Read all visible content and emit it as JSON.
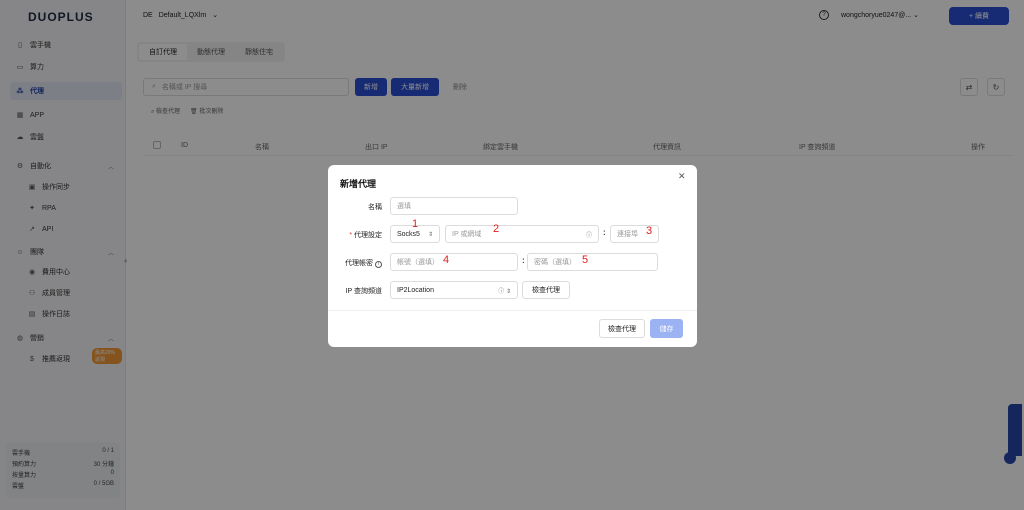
{
  "app": {
    "logo": "DUOPLUS"
  },
  "sidebar": {
    "items": [
      {
        "label": "雲手機",
        "icon": "phone-icon"
      },
      {
        "label": "算力",
        "icon": "monitor-icon"
      },
      {
        "label": "代理",
        "icon": "proxy-icon",
        "active": true
      },
      {
        "label": "APP",
        "icon": "grid-icon"
      },
      {
        "label": "雲盤",
        "icon": "cloud-icon"
      }
    ],
    "groups": [
      {
        "label": "自動化",
        "icon": "automation-icon",
        "children": [
          {
            "label": "操作同步",
            "icon": "sync-icon"
          },
          {
            "label": "RPA",
            "icon": "rpa-icon"
          },
          {
            "label": "API",
            "icon": "api-icon"
          }
        ]
      },
      {
        "label": "團隊",
        "icon": "team-icon",
        "children": [
          {
            "label": "費用中心",
            "icon": "wallet-icon"
          },
          {
            "label": "成員管理",
            "icon": "members-icon"
          },
          {
            "label": "操作日誌",
            "icon": "log-icon"
          }
        ]
      },
      {
        "label": "營銷",
        "icon": "marketing-icon",
        "children": [
          {
            "label": "推薦返現",
            "icon": "dollar-icon",
            "badge": "最高20%返現"
          }
        ]
      }
    ],
    "usage": [
      {
        "label": "雲手機",
        "value": "0 / 1"
      },
      {
        "label": "預約算力",
        "value": "30 分鐘"
      },
      {
        "label": "按量算力",
        "value": "0"
      },
      {
        "label": "雲盤",
        "value": "0 / 5GB"
      }
    ]
  },
  "topbar": {
    "env_region": "DE",
    "env_name": "Default_LQXlm",
    "account": "wongchoryue0247@...",
    "upgrade_label": "+ 續費"
  },
  "content": {
    "tabs": [
      {
        "label": "自訂代理",
        "active": true
      },
      {
        "label": "動態代理"
      },
      {
        "label": "靜態住宅"
      }
    ],
    "search_placeholder": "名稱或 IP 搜尋",
    "add_label": "新增",
    "bulk_add_label": "大量新增",
    "delete_label": "刪除",
    "batch_check": "檢查代理",
    "batch_delete": "批次刪除",
    "columns": [
      "ID",
      "名稱",
      "出口 IP",
      "綁定雲手機",
      "代理資訊",
      "IP 查詢頻道",
      "操作"
    ]
  },
  "modal": {
    "title": "新增代理",
    "name_label": "名稱",
    "name_placeholder": "選填",
    "proxy_label": "代理設定",
    "protocol_value": "Socks5",
    "host_placeholder": "IP 或網域",
    "port_placeholder": "連接埠",
    "account_label": "代理帳密",
    "username_placeholder": "帳號（選填）",
    "password_placeholder": "密碼（選填）",
    "ip_channel_label": "IP 查詢頻道",
    "ip_channel_value": "IP2Location",
    "check_proxy_label": "檢查代理",
    "footer_check_label": "檢查代理",
    "save_label": "儲存",
    "annotations": [
      "1",
      "2",
      "3",
      "4",
      "5"
    ]
  }
}
